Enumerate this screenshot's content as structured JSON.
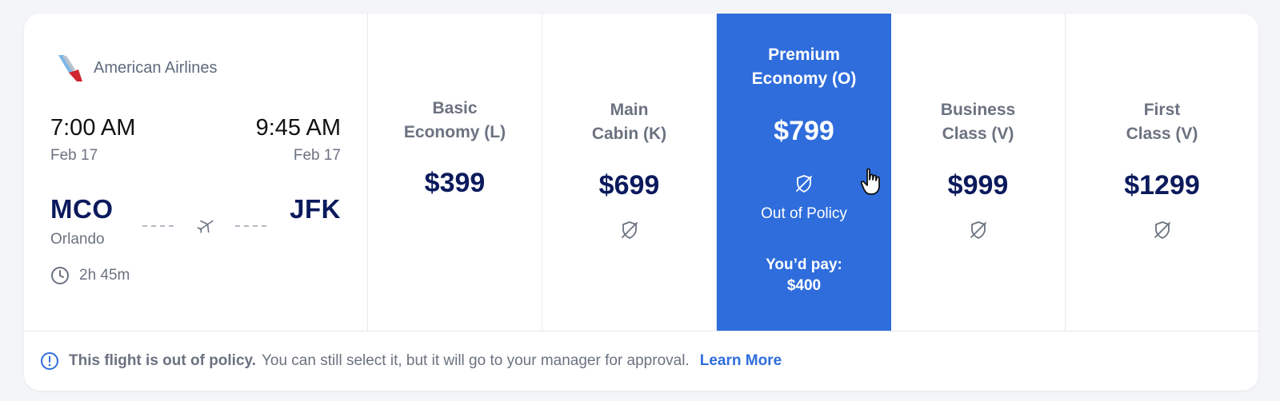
{
  "flight": {
    "airline": "American Airlines",
    "departure": {
      "time": "7:00 AM",
      "date": "Feb 17",
      "code": "MCO",
      "city": "Orlando"
    },
    "arrival": {
      "time": "9:45 AM",
      "date": "Feb 17",
      "code": "JFK"
    },
    "duration": "2h 45m"
  },
  "fares": [
    {
      "name_line1": "Basic",
      "name_line2": "Economy (L)",
      "price": "$399"
    },
    {
      "name_line1": "Main",
      "name_line2": "Cabin (K)",
      "price": "$699",
      "icon": "out-of-policy-icon"
    },
    {
      "name_line1": "Premium",
      "name_line2": "Economy (O)",
      "price": "$799",
      "icon": "out-of-policy-icon",
      "selected": true,
      "status": "Out of Policy",
      "pay_label": "You’d pay:",
      "pay_amount": "$400"
    },
    {
      "name_line1": "Business",
      "name_line2": "Class (V)",
      "price": "$999",
      "icon": "out-of-policy-icon"
    },
    {
      "name_line1": "First",
      "name_line2": "Class (V)",
      "price": "$1299",
      "icon": "out-of-policy-icon"
    }
  ],
  "footer": {
    "bold": "This flight is out of policy.",
    "message": "You can still select it, but it will go to your manager for approval.",
    "link": "Learn More"
  },
  "colors": {
    "accent": "#2f6ddc",
    "navy": "#0b1a5c",
    "muted": "#6b7280"
  }
}
